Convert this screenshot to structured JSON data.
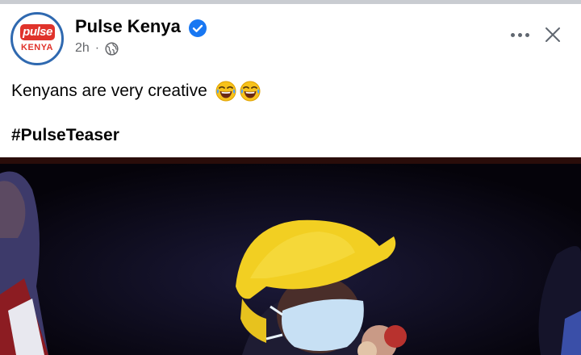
{
  "post": {
    "page_name": "Pulse Kenya",
    "verified": true,
    "time": "2h",
    "separator": "·",
    "audience_icon": "globe-icon",
    "text": "Kenyans are very creative",
    "emojis": [
      "face-with-tears-of-joy",
      "face-with-tears-of-joy"
    ],
    "hashtag": "#PulseTeaser"
  },
  "avatar": {
    "logo_top": "pulse",
    "logo_bottom": "KENYA"
  },
  "actions": {
    "more_icon": "more-horizontal-icon",
    "close_icon": "close-icon"
  },
  "colors": {
    "verified_blue": "#1877f2",
    "brand_red": "#e0332b",
    "secondary_text": "#65676b"
  }
}
